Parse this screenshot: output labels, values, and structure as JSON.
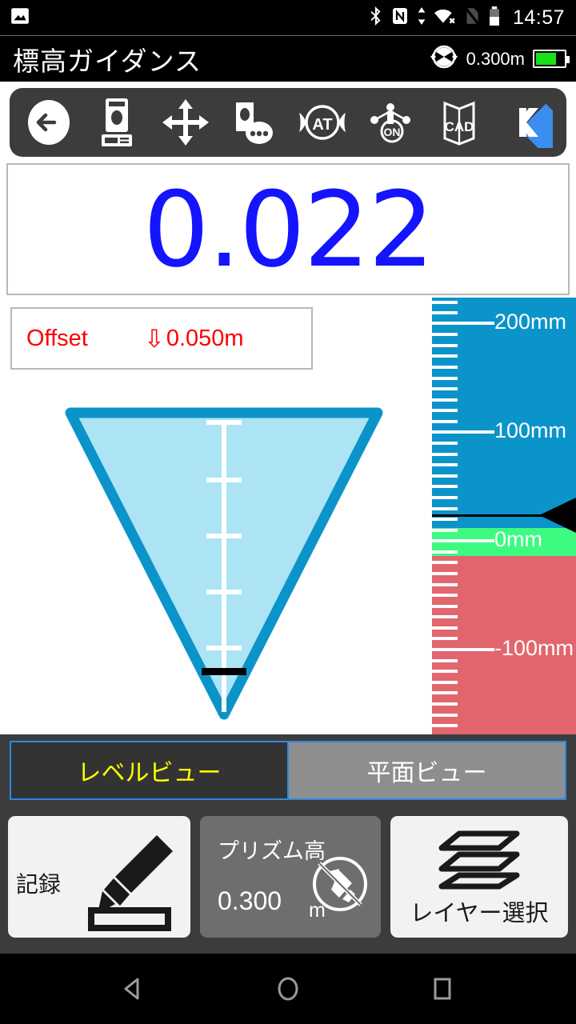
{
  "statusbar": {
    "icons": [
      "photo-icon",
      "bluetooth-icon",
      "nfc-icon",
      "data-transfer-icon",
      "wifi-off-icon",
      "sim-off-icon",
      "battery-icon"
    ],
    "clock": "14:57"
  },
  "titlebar": {
    "title": "標高ガイダンス",
    "prism_icon": "prism-target-icon",
    "prism_height": "0.300m",
    "battery_icon": "battery-full-icon"
  },
  "toolbar": {
    "items": [
      {
        "name": "back-button",
        "icon": "back-arrow-circle-icon"
      },
      {
        "name": "instrument-button",
        "icon": "total-station-icon"
      },
      {
        "name": "pan-button",
        "icon": "four-way-arrows-icon"
      },
      {
        "name": "instrument-settings-button",
        "icon": "total-station-more-icon"
      },
      {
        "name": "auto-tracking-button",
        "icon": "at-oval-icon"
      },
      {
        "name": "laser-on-button",
        "icon": "laser-on-icon"
      },
      {
        "name": "cad-button",
        "icon": "cad-book-icon"
      },
      {
        "name": "kiku-button",
        "icon": "k-diamond-icon"
      }
    ]
  },
  "main": {
    "cut_fill_value": "0.022",
    "offset_label": "Offset",
    "offset_arrow": "⇩",
    "offset_value": "0.050m",
    "value_color": "#1414ff",
    "offset_color": "#fb0000"
  },
  "gauge": {
    "labels": [
      {
        "text": "200mm",
        "mm": 200
      },
      {
        "text": "100mm",
        "mm": 100
      },
      {
        "text": "0mm",
        "mm": 0
      },
      {
        "text": "-100mm",
        "mm": -100
      }
    ],
    "pointer_mm": 22,
    "band_colors": {
      "above": "#0b94ca",
      "zero": "#3dfb81",
      "below": "#e2666e"
    },
    "pointer_icon": "gauge-pointer-arrow"
  },
  "funnel": {
    "icon": "inverted-triangle-level-icon",
    "outline_color": "#0b94ca",
    "fill_color": "#ace3f5",
    "marker_color": "#000000"
  },
  "tabs": [
    {
      "label": "レベルビュー",
      "active": true
    },
    {
      "label": "平面ビュー",
      "active": false
    }
  ],
  "bottom_buttons": {
    "record": {
      "label": "記録",
      "icon": "pencil-record-icon"
    },
    "prism": {
      "title": "プリズム高",
      "value": "0.300",
      "unit": "m",
      "icon": "pencil-disabled-icon"
    },
    "layer": {
      "label": "レイヤー選択",
      "icon": "layers-stack-icon"
    }
  },
  "navbar": {
    "back": "nav-back-icon",
    "home": "nav-home-icon",
    "recent": "nav-recent-icon"
  }
}
